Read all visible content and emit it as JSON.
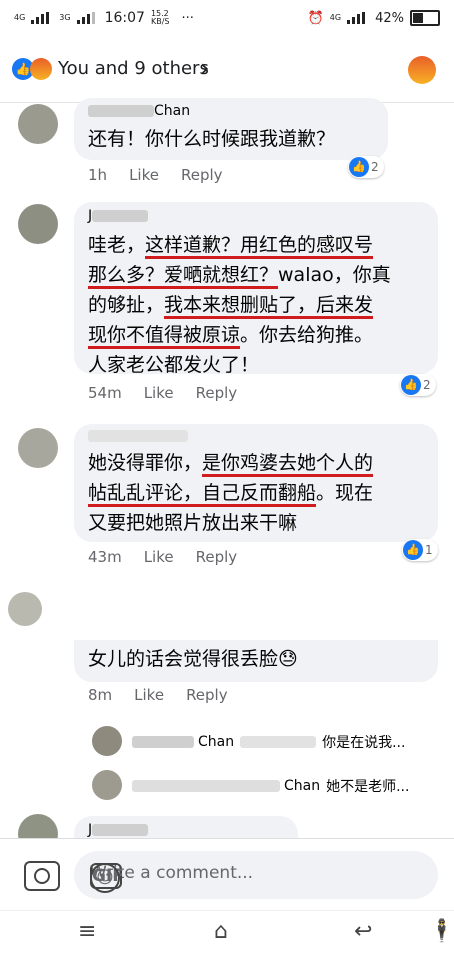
{
  "status": {
    "net1": "4G",
    "net2": "3G",
    "speed": "15.2",
    "speed_unit": "KB/S",
    "time": "16:07",
    "more": "···",
    "alarm": "⏰",
    "net_right": "4G",
    "battery": "42%"
  },
  "header": {
    "reactions_text": "You and 9 others",
    "chevron": "›",
    "like_icon": "thumbs-up-icon",
    "angry_icon": "angry-face-icon"
  },
  "comments": [
    {
      "name": "Chan",
      "lines": [
        "还有！你什么时候跟我道歉？"
      ],
      "time": "1h",
      "like": "Like",
      "reply": "Reply",
      "reactions": "2"
    },
    {
      "name": "J",
      "lines": [
        {
          "pre": "哇老，",
          "ul": "这样道歉？用红色的感叹号",
          "post": ""
        },
        {
          "pre": "",
          "ul": "那么多？爱嗮就想红？",
          "post": "walao，你真"
        },
        {
          "pre": "的够扯，",
          "ul": "我本来想删贴了，后来发",
          "post": ""
        },
        {
          "pre": "",
          "ul": "现你不值得被原谅",
          "post": "。你去给狗推。"
        },
        {
          "pre": "人家老公都发火了！",
          "ul": "",
          "post": ""
        }
      ],
      "time": "54m",
      "like": "Like",
      "reply": "Reply",
      "reactions": "2"
    },
    {
      "name": "",
      "lines": [
        {
          "pre": "她没得罪你，",
          "ul": "是你鸡婆去她个人的",
          "post": ""
        },
        {
          "pre": "",
          "ul": "帖乱乱评论，自己反而翻船",
          "post": "。现在"
        },
        {
          "pre": "又要把她照片放出来干嘛",
          "ul": "",
          "post": ""
        }
      ],
      "time": "43m",
      "like": "Like",
      "reply": "Reply",
      "reactions": "1"
    },
    {
      "name": "",
      "lines": [
        "女儿的话会觉得很丢脸😓"
      ],
      "time": "8m",
      "like": "Like",
      "reply": "Reply"
    }
  ],
  "replies": [
    {
      "name": "Chan",
      "text": "你是在说我..."
    },
    {
      "name": "Chan",
      "text": "她不是老师..."
    }
  ],
  "last_comment_name": "J",
  "composer": {
    "placeholder": "Write a comment...",
    "gif": "GIF",
    "smile": "☺"
  },
  "nav": {
    "menu": "≡",
    "home": "⌂",
    "back": "↩",
    "assist": "🕴"
  },
  "colors": {
    "fb_blue": "#1877f2",
    "underline_red": "#d01c1c",
    "bubble_gray": "#f0f2f5"
  }
}
